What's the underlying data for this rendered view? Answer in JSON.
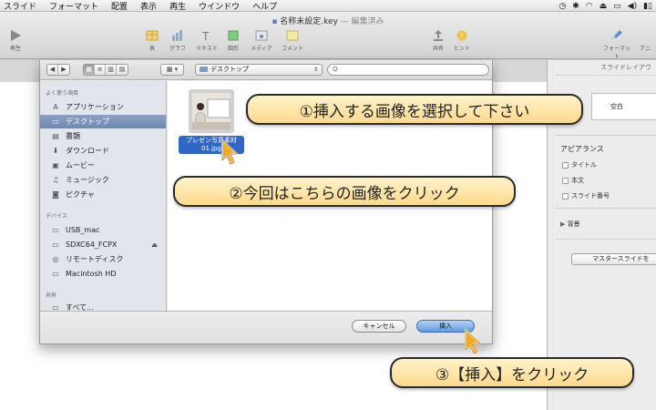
{
  "menubar": {
    "items": [
      "スライド",
      "フォーマット",
      "配置",
      "表示",
      "再生",
      "ウインドウ",
      "ヘルプ"
    ]
  },
  "window": {
    "title": "名称未設定.key",
    "edited_status": "— 編集済み"
  },
  "toolbar": {
    "play_label": "再生",
    "table_label": "表",
    "chart_label": "グラフ",
    "text_label": "テキスト",
    "shape_label": "図形",
    "media_label": "メディア",
    "comment_label": "コメント",
    "share_label": "共有",
    "tips_label": "ヒント",
    "format_label": "フォーマット",
    "animate_label": "アニ"
  },
  "dialog": {
    "path_label": "デスクトップ",
    "search_placeholder": "Q",
    "sidebar": {
      "favorites_header": "よく使う項目",
      "favorites": [
        {
          "label": "アプリケーション",
          "icon": "app-icon"
        },
        {
          "label": "デスクトップ",
          "icon": "desktop-icon",
          "selected": true
        },
        {
          "label": "書類",
          "icon": "documents-icon"
        },
        {
          "label": "ダウンロード",
          "icon": "download-icon"
        },
        {
          "label": "ムービー",
          "icon": "movie-icon"
        },
        {
          "label": "ミュージック",
          "icon": "music-icon"
        },
        {
          "label": "ピクチャ",
          "icon": "camera-icon"
        }
      ],
      "devices_header": "デバイス",
      "devices": [
        {
          "label": "USB_mac",
          "icon": "disk-icon"
        },
        {
          "label": "SDXC64_FCPX",
          "icon": "disk-icon",
          "ejectable": true
        },
        {
          "label": "リモートディスク",
          "icon": "remote-disk-icon"
        },
        {
          "label": "Macintosh HD",
          "icon": "disk-icon"
        }
      ],
      "shared_header": "共有",
      "shared": [
        {
          "label": "すべて...",
          "icon": "network-icon"
        }
      ]
    },
    "file": {
      "name_line1": "プレゼン写真素材",
      "name_line2": "01.jpg"
    },
    "cancel_label": "キャンセル",
    "insert_label": "挿入"
  },
  "inspector": {
    "title": "スライドレイアウ",
    "layout_name": "空白",
    "appearance_header": "アピアランス",
    "checkboxes": [
      "タイトル",
      "本文",
      "スライド番号"
    ],
    "background_label": "背景",
    "master_button_label": "マスタースライドを"
  },
  "callouts": {
    "step1": "①挿入する画像を選択して下さい",
    "step2": "②今回はこちらの画像をクリック",
    "step3": "③【挿入】をクリック"
  }
}
